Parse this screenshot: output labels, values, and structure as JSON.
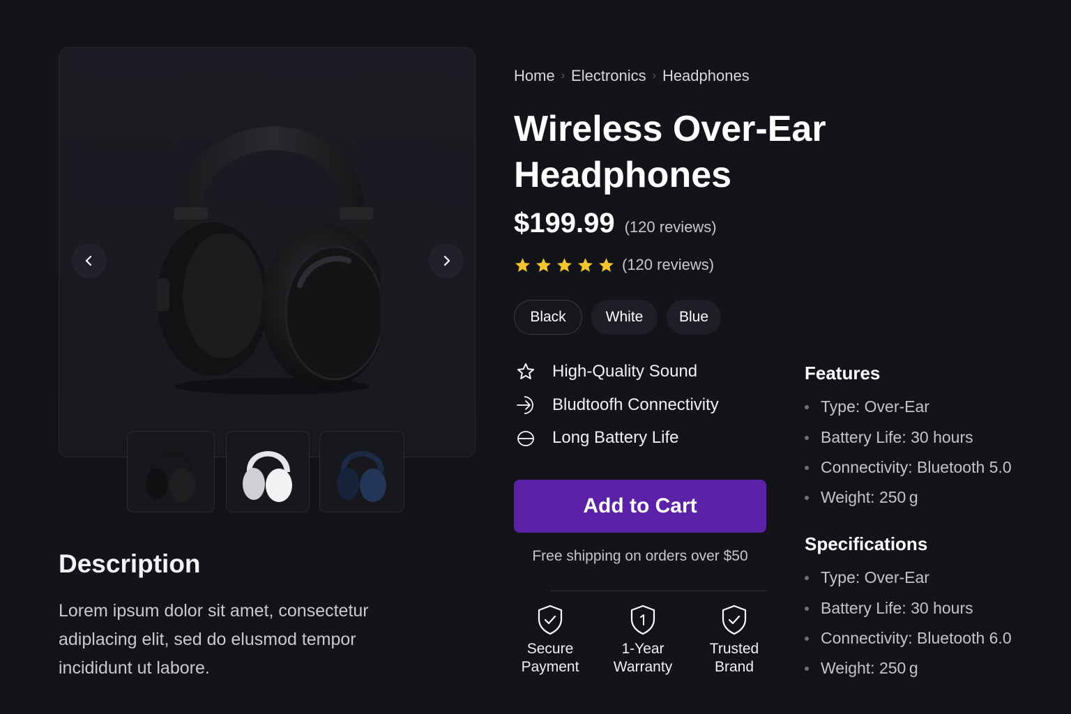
{
  "gallery": {
    "prev_icon": "chevron-left-icon",
    "next_icon": "chevron-right-icon",
    "thumbnails": [
      {
        "color": "Black",
        "hex": "#1c1c1f"
      },
      {
        "color": "White",
        "hex": "#e9e9ec"
      },
      {
        "color": "Blue",
        "hex": "#1f2f4e"
      }
    ]
  },
  "description": {
    "title": "Description",
    "text": "Lorem ipsum dolor sit amet, consectetur adiplacing elit, sed do elusmod tempor incididunt ut labore."
  },
  "breadcrumb": [
    "Home",
    "Electronics",
    "Headphones"
  ],
  "product": {
    "title": "Wireless Over-Ear Headphones",
    "price": "$199.99",
    "price_reviews": "(120 reviews)",
    "rating": 5,
    "rating_reviews": "(120 reviews)",
    "star_color": "#f4c430"
  },
  "swatches": [
    {
      "label": "Black",
      "selected": true
    },
    {
      "label": "White",
      "selected": false
    },
    {
      "label": "Blue",
      "selected": false
    }
  ],
  "highlights": [
    {
      "icon": "star-outline-icon",
      "label": "High-Quality Sound"
    },
    {
      "icon": "bluetooth-arrow-icon",
      "label": "Bludtoofh Connectivity"
    },
    {
      "icon": "battery-icon",
      "label": "Long Battery Life"
    }
  ],
  "cart": {
    "label": "Add to Cart",
    "color": "#5b21a6",
    "shipping": "Free shipping on orders over $50"
  },
  "badges": [
    {
      "icon": "shield-check-icon",
      "line1": "Secure",
      "line2": "Payment"
    },
    {
      "icon": "shield-one-icon",
      "line1": "1-Year",
      "line2": "Warranty"
    },
    {
      "icon": "shield-check-icon",
      "line1": "Trusted",
      "line2": "Brand"
    }
  ],
  "features": {
    "title": "Features",
    "items": [
      "Type: Over-Ear",
      "Battery Life: 30 hours",
      "Connectivity: Bluetooth 5.0",
      "Weight: 250 g"
    ]
  },
  "specifications": {
    "title": "Specifications",
    "items": [
      "Type: Over-Ear",
      "Battery Life: 30 hours",
      "Connectivity: Bluetooth 6.0",
      "Weight: 250 g"
    ]
  }
}
